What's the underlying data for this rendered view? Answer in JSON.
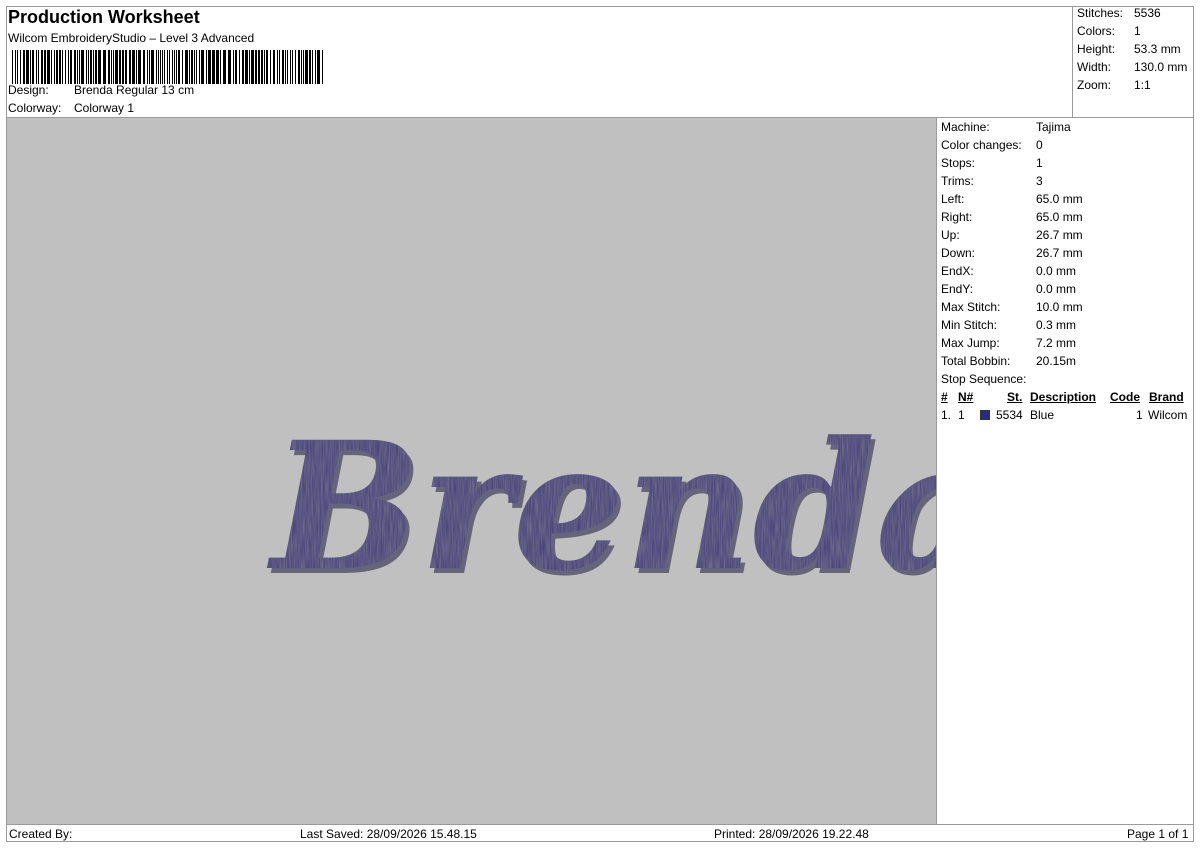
{
  "header": {
    "title": "Production Worksheet",
    "subtitle": "Wilcom EmbroideryStudio – Level 3 Advanced",
    "design_label": "Design:",
    "design_value": "Brenda Regular 13 cm",
    "colorway_label": "Colorway:",
    "colorway_value": "Colorway 1"
  },
  "summary": [
    {
      "label": "Stitches:",
      "value": "5536"
    },
    {
      "label": "Colors:",
      "value": "1"
    },
    {
      "label": "Height:",
      "value": "53.3 mm"
    },
    {
      "label": "Width:",
      "value": "130.0 mm"
    },
    {
      "label": "Zoom:",
      "value": "1:1"
    }
  ],
  "design_preview": {
    "text": "Brenda",
    "thread_color": "#3f3778",
    "background": "#c0c0c0"
  },
  "properties": [
    {
      "label": "Machine:",
      "value": "Tajima"
    },
    {
      "label": "Color changes:",
      "value": "0"
    },
    {
      "label": "Stops:",
      "value": "1"
    },
    {
      "label": "Trims:",
      "value": "3"
    },
    {
      "label": "Left:",
      "value": "65.0 mm"
    },
    {
      "label": "Right:",
      "value": "65.0 mm"
    },
    {
      "label": "Up:",
      "value": "26.7 mm"
    },
    {
      "label": "Down:",
      "value": "26.7 mm"
    },
    {
      "label": "EndX:",
      "value": "0.0 mm"
    },
    {
      "label": "EndY:",
      "value": "0.0 mm"
    },
    {
      "label": "Max Stitch:",
      "value": "10.0 mm"
    },
    {
      "label": "Min Stitch:",
      "value": "0.3 mm"
    },
    {
      "label": "Max Jump:",
      "value": "7.2 mm"
    },
    {
      "label": "Total Bobbin:",
      "value": "20.15m"
    }
  ],
  "stop_sequence": {
    "label": "Stop Sequence:",
    "columns": [
      "#",
      "N#",
      "St.",
      "Description",
      "Code",
      "Brand"
    ],
    "rows": [
      {
        "index": "1.",
        "n": "1",
        "color": "#2a2a80",
        "stitches": "5534",
        "description": "Blue",
        "code": "1",
        "brand": "Wilcom"
      }
    ]
  },
  "footer": {
    "created_by": "Created By:",
    "last_saved": "Last Saved: 28/09/2026 15.48.15",
    "printed": "Printed: 28/09/2026 19.22.48",
    "page": "Page 1 of 1"
  }
}
